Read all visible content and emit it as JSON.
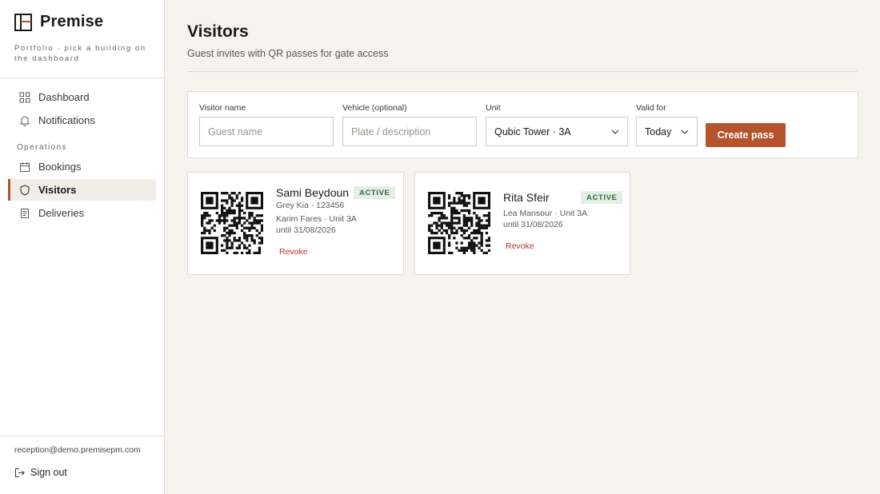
{
  "brand": {
    "name": "Premise",
    "subtitle": "Portfolio · pick a building on the dashboard"
  },
  "nav": {
    "dashboard": "Dashboard",
    "notifications": "Notifications",
    "section_operations": "Operations",
    "bookings": "Bookings",
    "visitors": "Visitors",
    "deliveries": "Deliveries",
    "active_item": "Visitors"
  },
  "account": {
    "email": "reception@demo.premisepm.com",
    "signout": "Sign out"
  },
  "page": {
    "title": "Visitors",
    "subtitle": "Guest invites with QR passes for gate access"
  },
  "form": {
    "visitor_label": "Visitor name",
    "visitor_placeholder": "Guest name",
    "visitor_value": "",
    "vehicle_label": "Vehicle (optional)",
    "vehicle_placeholder": "Plate / description",
    "vehicle_value": "",
    "unit_label": "Unit",
    "unit_value": "Qubic Tower · 3A",
    "valid_label": "Valid for",
    "valid_value": "Today",
    "create_label": "Create pass"
  },
  "passes": [
    {
      "guest": "Sami Beydoun",
      "status": "ACTIVE",
      "vehicle": "Grey Kia · 123456",
      "host": "Karim Fares · Unit 3A",
      "valid_until": "until 31/08/2026",
      "action": "Revoke"
    },
    {
      "guest": "Rita Sfeir",
      "status": "ACTIVE",
      "host": "Lea Mansour · Unit 3A",
      "valid_until": "until 31/08/2026",
      "action": "Revoke"
    }
  ],
  "colors": {
    "accent": "#b5542c",
    "badge_bg": "#e3efe4",
    "badge_text": "#2e6b3a",
    "revoke": "#b3322a",
    "background": "#f5f3ee"
  },
  "icons": {
    "dashboard": "grid-icon",
    "notifications": "bell-icon",
    "bookings": "calendar-icon",
    "visitors": "shield-icon",
    "deliveries": "receipt-icon",
    "signout": "sign-out-icon"
  }
}
